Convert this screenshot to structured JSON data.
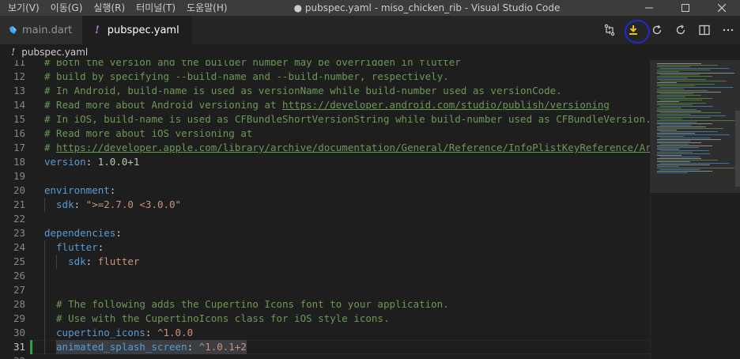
{
  "menu": [
    "보기(V)",
    "이동(G)",
    "실행(R)",
    "터미널(T)",
    "도움말(H)"
  ],
  "window_title": "● pubspec.yaml - miso_chicken_rib - Visual Studio Code",
  "tabs": [
    {
      "label": "main.dart",
      "icon": "dart-icon",
      "active": false
    },
    {
      "label": "pubspec.yaml",
      "icon": "yaml-icon",
      "active": true,
      "dirty": true
    }
  ],
  "breadcrumb": "pubspec.yaml",
  "editor_actions": [
    "source-control-compare-icon",
    "flutter-pub-get-icon",
    "refresh-icon",
    "restart-icon",
    "split-editor-icon",
    "more-actions-icon"
  ],
  "lines": [
    {
      "num": "11",
      "text": "# Both the version and the builder number may be overridden in flutter",
      "type": "comment"
    },
    {
      "num": "12",
      "text": "# build by specifying --build-name and --build-number, respectively.",
      "type": "comment"
    },
    {
      "num": "13",
      "text": "# In Android, build-name is used as versionName while build-number used as versionCode.",
      "type": "comment"
    },
    {
      "num": "14",
      "text": "# Read more about Android versioning at ",
      "link": "https://developer.android.com/studio/publish/versioning",
      "type": "comment"
    },
    {
      "num": "15",
      "text": "# In iOS, build-name is used as CFBundleShortVersionString while build-number used as CFBundleVersion.",
      "type": "comment"
    },
    {
      "num": "16",
      "text": "# Read more about iOS versioning at",
      "type": "comment"
    },
    {
      "num": "17",
      "text": "# ",
      "link": "https://developer.apple.com/library/archive/documentation/General/Reference/InfoPlistKeyReference/Artic",
      "type": "comment"
    },
    {
      "num": "18",
      "key": "version",
      "value": "1.0.0+1",
      "vtype": "num",
      "indent": 0
    },
    {
      "num": "19",
      "text": "",
      "type": "blank"
    },
    {
      "num": "20",
      "key": "environment",
      "value": "",
      "indent": 0
    },
    {
      "num": "21",
      "key": "sdk",
      "value": "\">=2.7.0 <3.0.0\"",
      "vtype": "str",
      "indent": 1
    },
    {
      "num": "22",
      "text": "",
      "type": "blank"
    },
    {
      "num": "23",
      "key": "dependencies",
      "value": "",
      "indent": 0
    },
    {
      "num": "24",
      "key": "flutter",
      "value": "",
      "indent": 1
    },
    {
      "num": "25",
      "key": "sdk",
      "value": "flutter",
      "vtype": "str",
      "indent": 2
    },
    {
      "num": "26",
      "text": "",
      "type": "blank",
      "indent": 1
    },
    {
      "num": "27",
      "text": "",
      "type": "blank",
      "indent": 1
    },
    {
      "num": "28",
      "text": "# The following adds the Cupertino Icons font to your application.",
      "type": "comment",
      "indent": 1
    },
    {
      "num": "29",
      "text": "# Use with the CupertinoIcons class for iOS style icons.",
      "type": "comment",
      "indent": 1
    },
    {
      "num": "30",
      "key": "cupertino_icons",
      "value": "^1.0.0",
      "vtype": "str",
      "indent": 1
    },
    {
      "num": "31",
      "key": "animated_splash_screen",
      "value": "^1.0.1+2",
      "vtype": "str",
      "indent": 1,
      "active": true
    },
    {
      "num": "32",
      "text": "",
      "type": "blank"
    }
  ],
  "colors": {
    "comment": "#6a9955",
    "key": "#569cd6",
    "string": "#ce9178",
    "highlight_ring": "#1a2bd6"
  }
}
